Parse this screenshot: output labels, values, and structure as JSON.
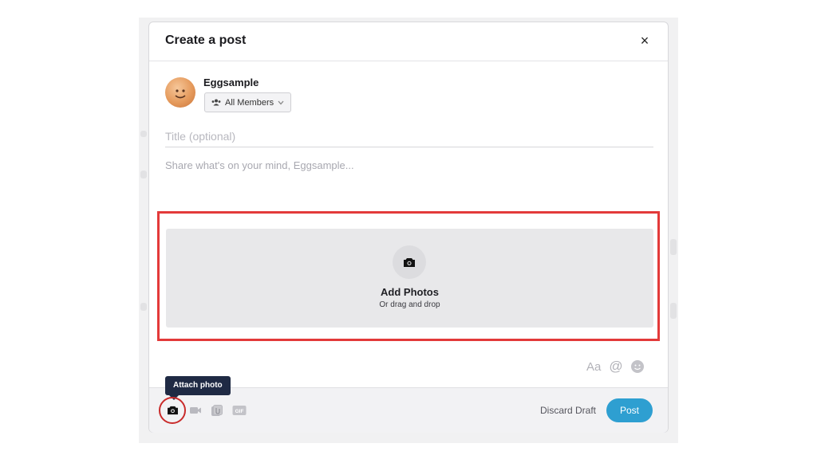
{
  "modal": {
    "title": "Create a post",
    "close_label": "×"
  },
  "author": {
    "name": "Eggsample",
    "audience": "All Members"
  },
  "title_field": {
    "placeholder": "Title (optional)",
    "value": ""
  },
  "body_field": {
    "placeholder": "Share what's on your mind, Eggsample...",
    "value": ""
  },
  "dropzone": {
    "title": "Add Photos",
    "subtitle": "Or drag and drop"
  },
  "format_tools": {
    "text_format_label": "Aa",
    "mention_label": "@"
  },
  "footer": {
    "tooltip": "Attach photo",
    "gif_label": "GIF",
    "discard_label": "Discard Draft",
    "post_label": "Post"
  },
  "colors": {
    "accent": "#2e9fd1",
    "highlight": "#e33a3a",
    "tooltip_bg": "#1f2a44"
  }
}
